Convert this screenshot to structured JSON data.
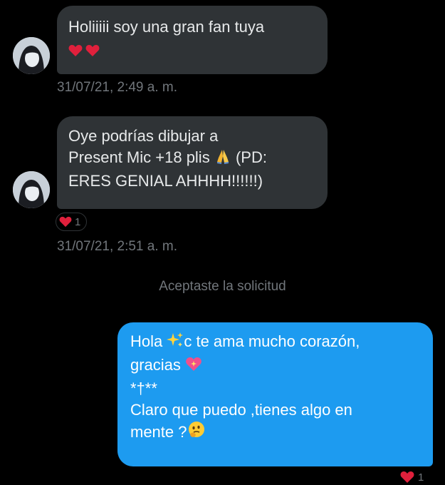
{
  "colors": {
    "background": "#000000",
    "incoming_bubble": "#2f3336",
    "outgoing_bubble": "#1d9bf0",
    "meta_text": "#71767b",
    "heart": "#e0203c"
  },
  "messages": [
    {
      "lines": [
        "Holiiiii soy una gran fan tuya"
      ],
      "emoji": [
        "red-heart-icon",
        "red-heart-icon"
      ],
      "timestamp": "31/07/21, 2:49 a. m."
    },
    {
      "lines": [
        "Oye podrías dibujar a",
        "Present Mic +18 plis",
        " (PD:",
        "ERES GENIAL AHHHH!!!!!!)"
      ],
      "emoji": [
        "folded-hands-icon"
      ],
      "reaction_count": "1",
      "timestamp": "31/07/21, 2:51 a. m."
    }
  ],
  "system_message": "Aceptaste la solicitud",
  "reply": {
    "lines": [
      "Hola ",
      "c te ama mucho corazón,",
      "gracias ",
      "*†**",
      "Claro que puedo ,tienes algo en",
      "mente ?"
    ],
    "emoji": [
      "sparkles-icon",
      "sparkling-heart-icon",
      "thinking-face-icon"
    ],
    "reaction_count": "1"
  }
}
